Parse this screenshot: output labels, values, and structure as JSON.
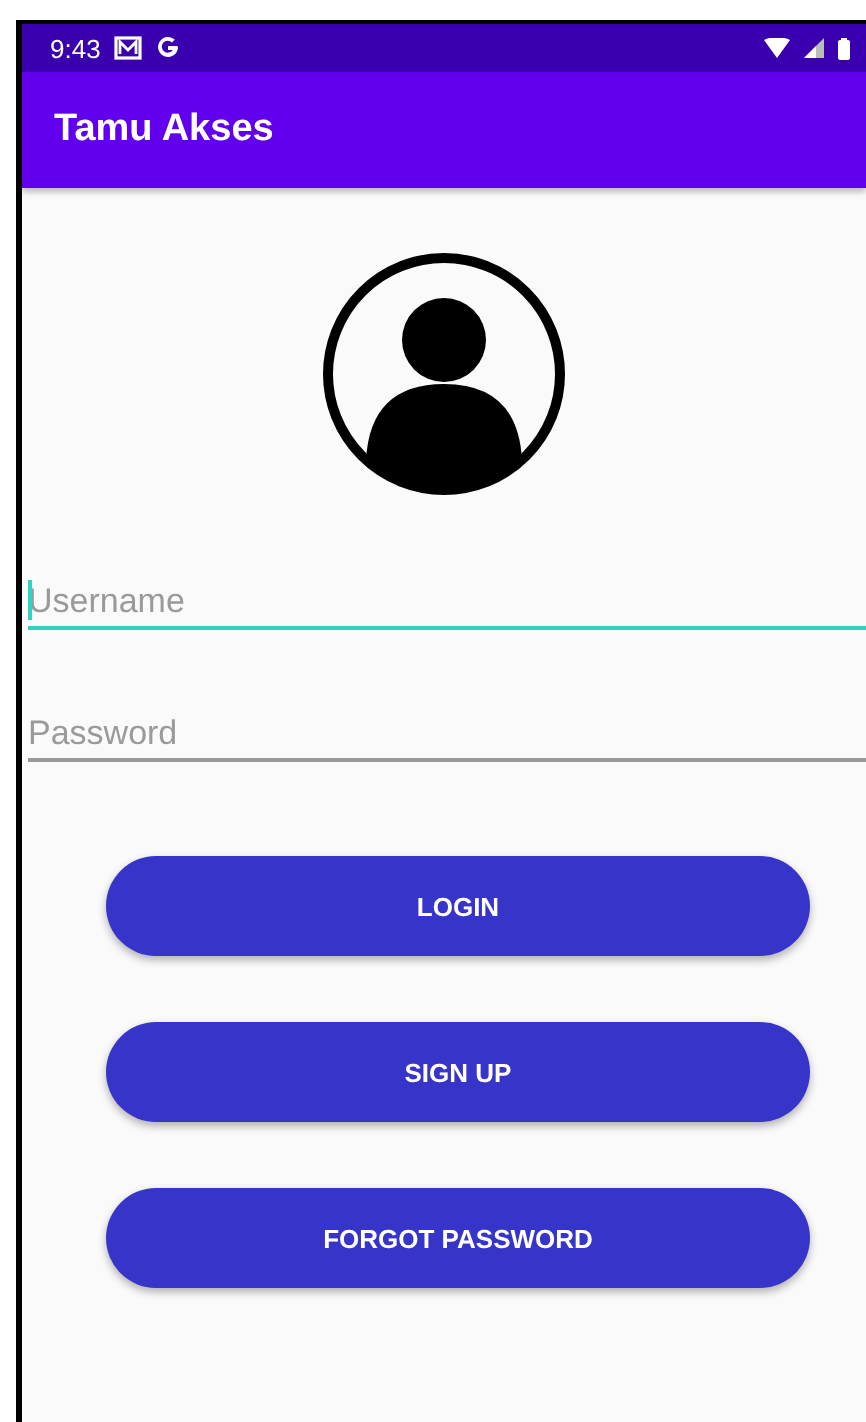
{
  "status_bar": {
    "time": "9:43",
    "notification_icons": [
      {
        "kind": "mail"
      },
      {
        "kind": "google"
      }
    ]
  },
  "app_bar": {
    "title": "Tamu Akses"
  },
  "fields": [
    {
      "placeholder": "Username",
      "focused": true
    },
    {
      "placeholder": "Password",
      "focused": false
    }
  ],
  "buttons": [
    "LOGIN",
    "SIGN UP",
    "FORGOT PASSWORD"
  ]
}
